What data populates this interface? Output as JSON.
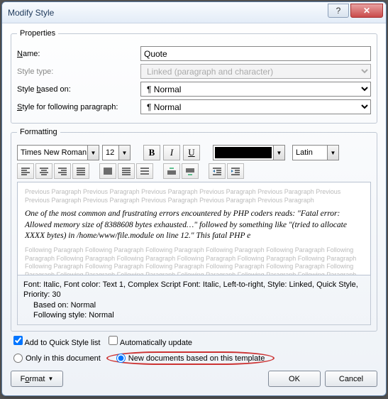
{
  "title": "Modify Style",
  "properties": {
    "legend": "Properties",
    "name_label": "Name:",
    "name_value": "Quote",
    "type_label": "Style type:",
    "type_value": "Linked (paragraph and character)",
    "based_label": "Style based on:",
    "based_value": "Normal",
    "following_label": "Style for following paragraph:",
    "following_value": "Normal"
  },
  "formatting": {
    "legend": "Formatting",
    "font": "Times New Roman",
    "size": "12",
    "script": "Latin"
  },
  "preview": {
    "prev": "Previous Paragraph Previous Paragraph Previous Paragraph Previous Paragraph Previous Paragraph Previous Previous Paragraph Previous Paragraph Previous Paragraph Previous Paragraph Previous Paragraph",
    "sample": "One of the most common and frustrating errors encountered by PHP coders reads: \"Fatal error: Allowed memory size of 8388608 bytes exhausted…\" followed by something like \"(tried to allocate XXXX bytes) in /home/www/file.module on line 12.\" This fatal PHP e",
    "next": "Following Paragraph Following Paragraph Following Paragraph Following Paragraph Following Paragraph Following Paragraph Following Paragraph Following Paragraph Following Paragraph Following Paragraph Following Paragraph Following Paragraph Following Paragraph Following Paragraph Following Paragraph Following Paragraph Following Paragraph Following Paragraph Following Paragraph Following Paragraph Following Paragraph Following Paragraph Following Paragraph Following Paragraph Following Paragraph"
  },
  "description": {
    "line1": "Font: Italic, Font color: Text 1, Complex Script Font: Italic, Left-to-right, Style: Linked, Quick Style,",
    "line2": "Priority: 30",
    "line3": "Based on: Normal",
    "line4": "Following style: Normal"
  },
  "checks": {
    "quick": "Add to Quick Style list",
    "auto": "Automatically update",
    "only": "Only in this document",
    "newdoc": "New documents based on this template"
  },
  "buttons": {
    "format": "Format",
    "ok": "OK",
    "cancel": "Cancel"
  }
}
